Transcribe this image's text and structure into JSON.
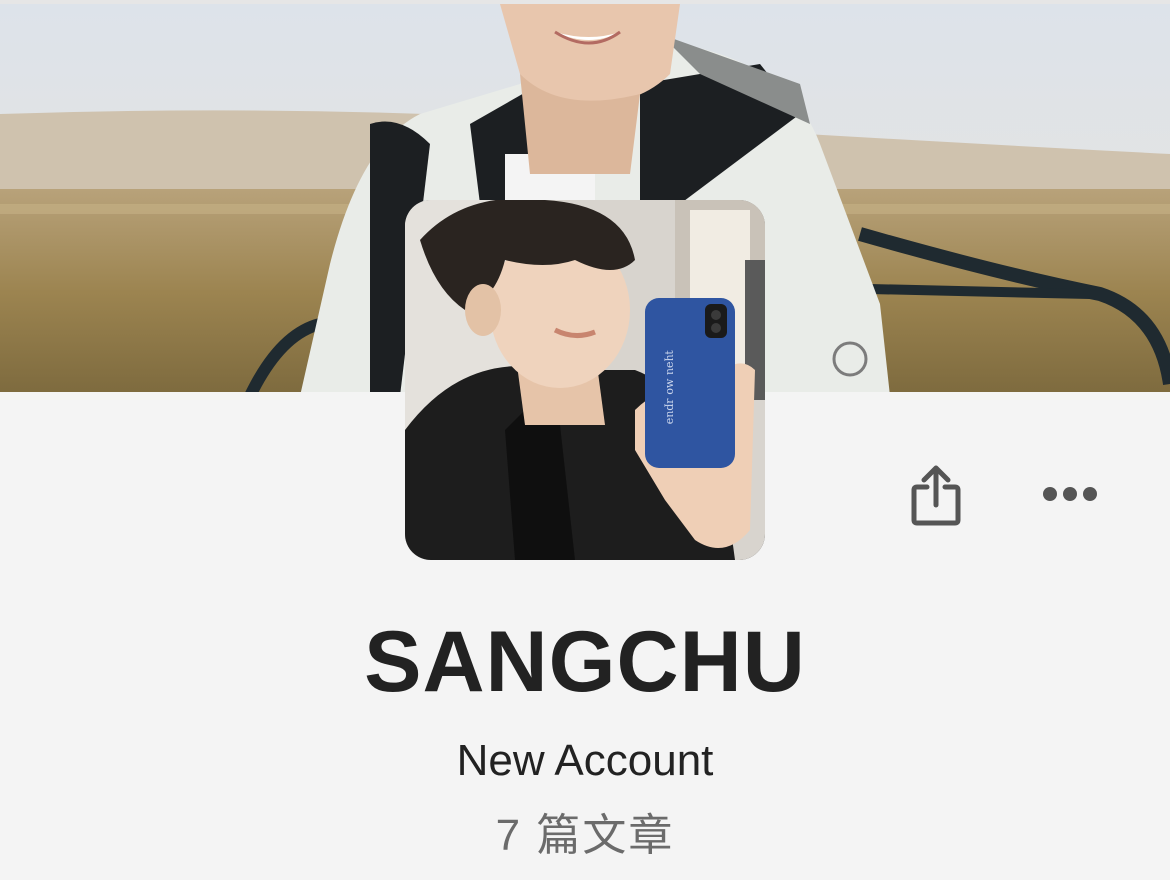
{
  "profile": {
    "name": "SANGCHU",
    "bio": "New Account",
    "post_count": "7 篇文章"
  },
  "actions": {
    "share_icon": "share-icon",
    "more_icon": "more-icon"
  },
  "colors": {
    "background": "#f4f4f4",
    "name_text": "#222222",
    "count_text": "#6b6b6b",
    "icon": "#555555"
  }
}
